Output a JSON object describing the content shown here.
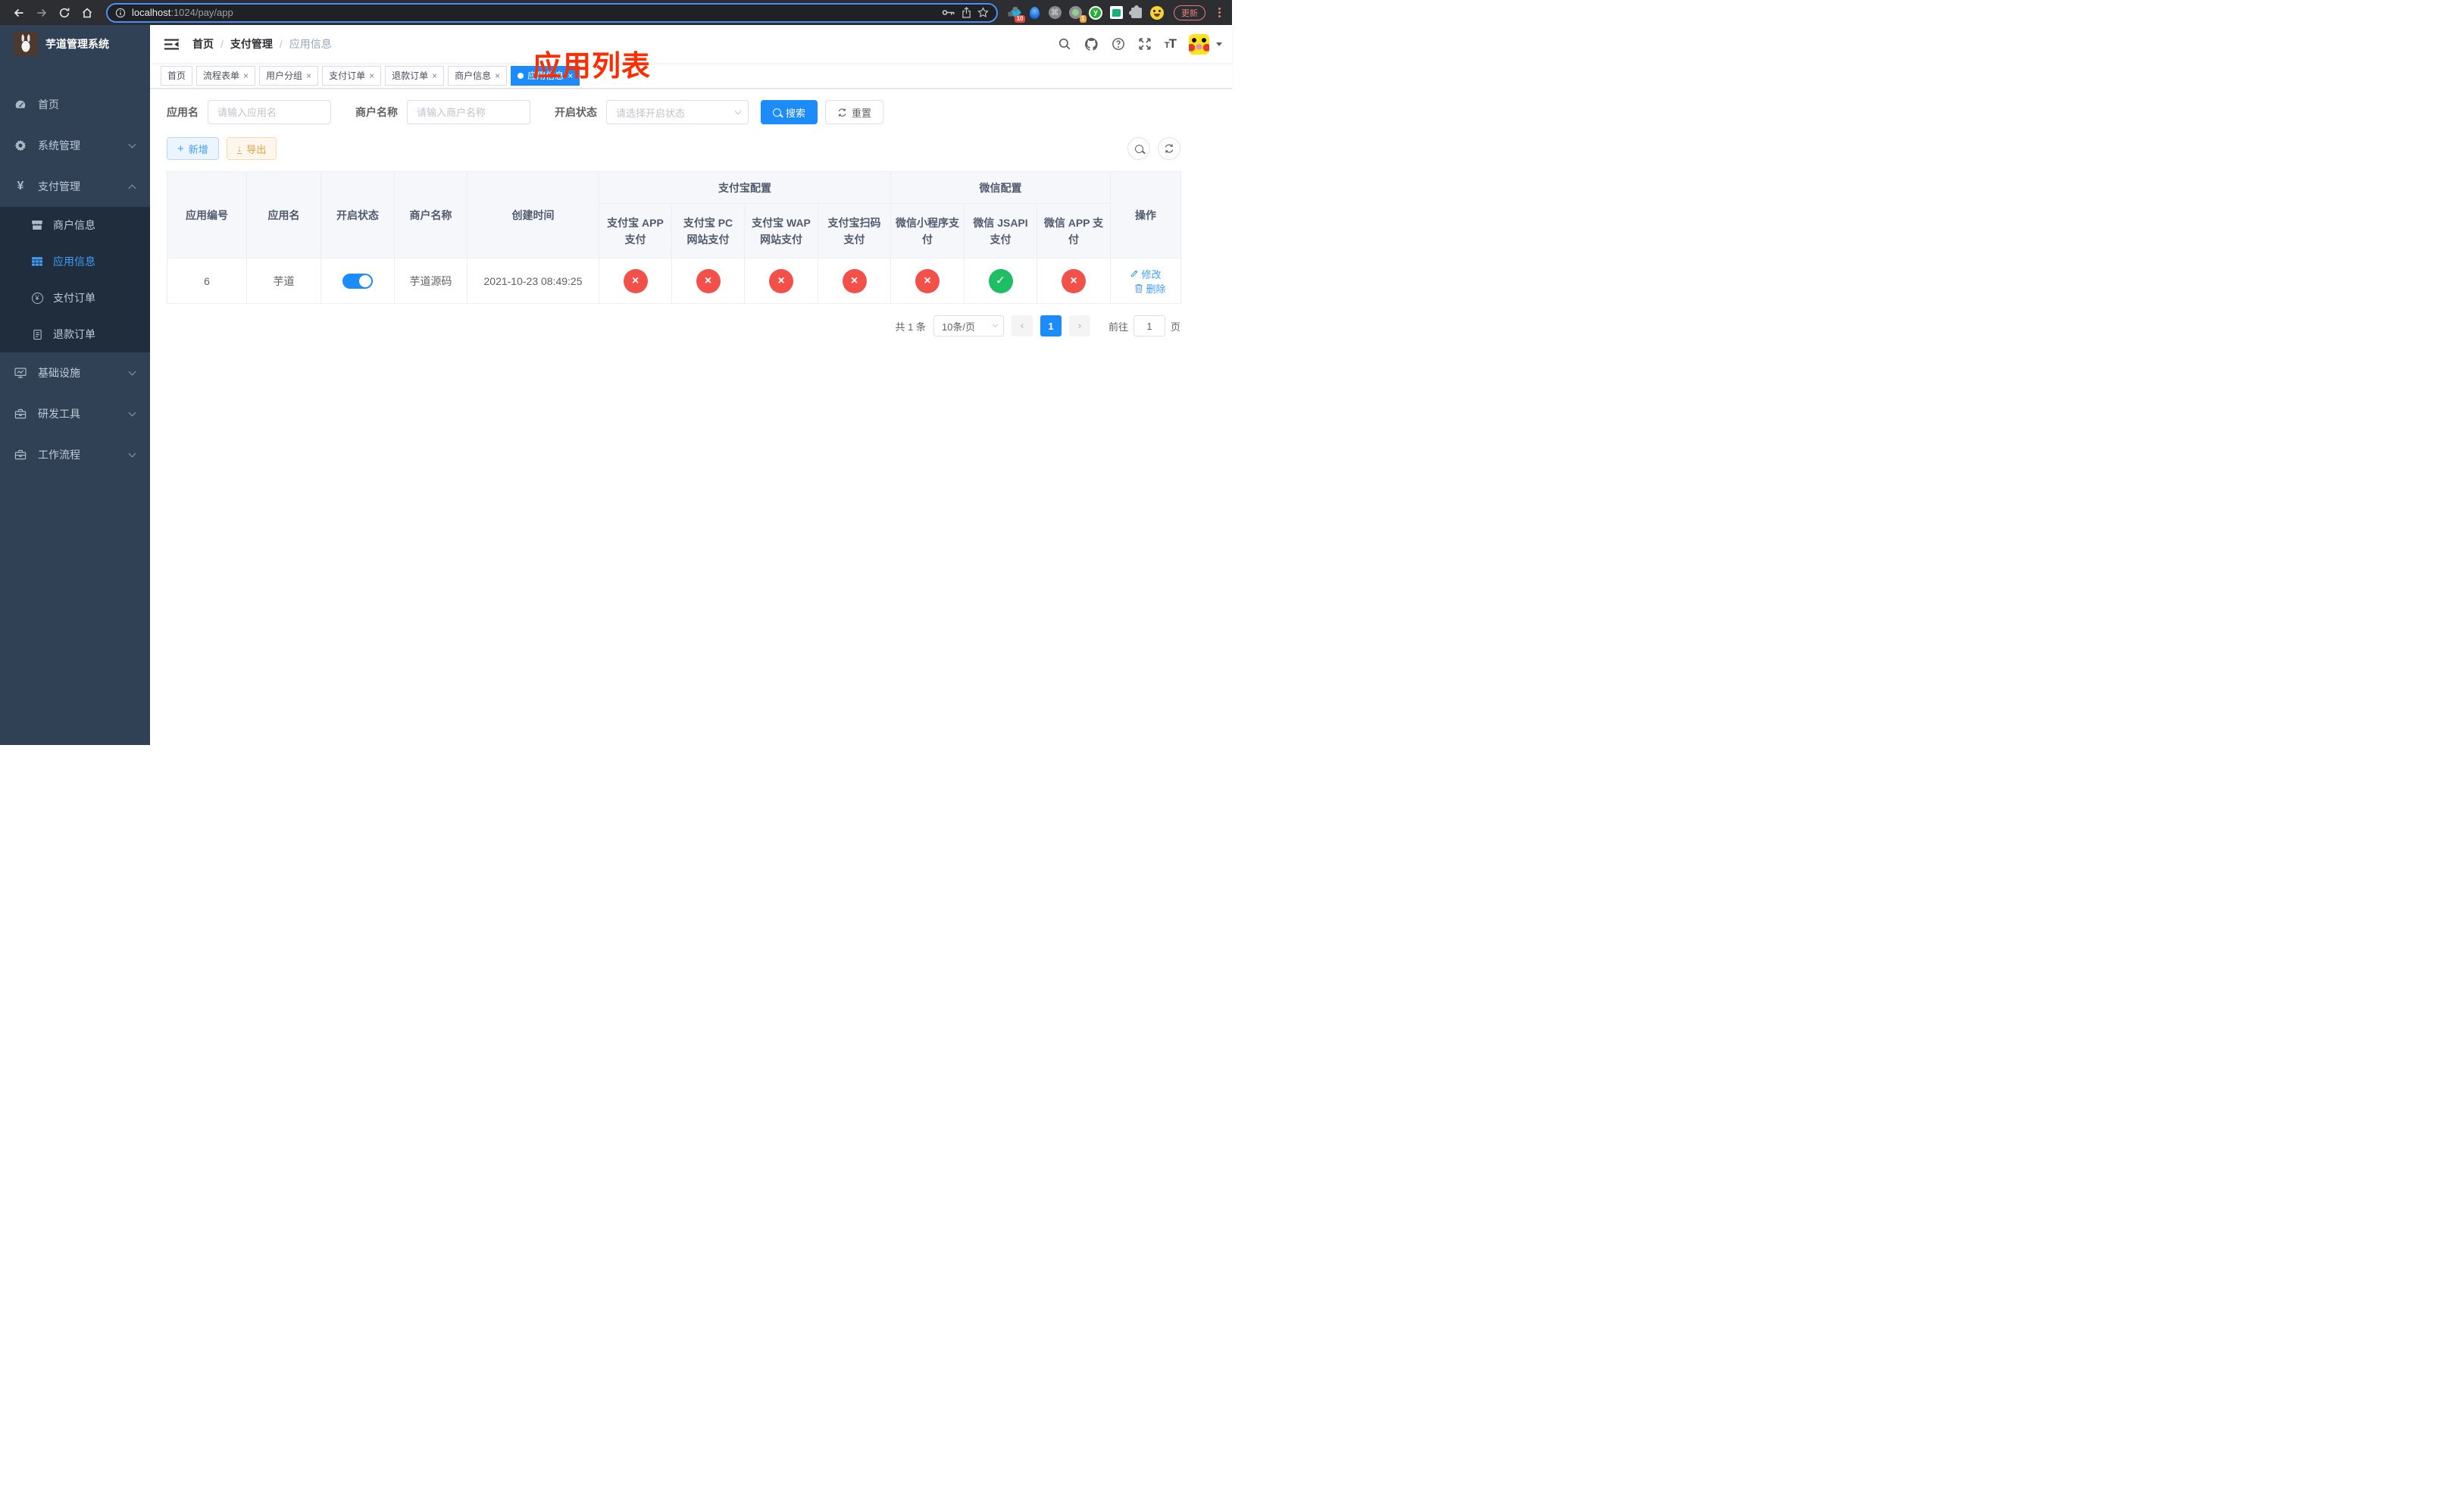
{
  "colors": {
    "accent": "#1b8cfa",
    "link": "#409eff",
    "danger": "#f4504a",
    "success": "#1dbe64",
    "warning": "#e6a23c",
    "sidebar_bg": "#304156",
    "submenu_bg": "#1f2d3d",
    "annotation_red": "#fd2c01"
  },
  "browser": {
    "url_host": "localhost",
    "url_rest": ":1024/pay/app",
    "update_label": "更新",
    "badge_pinned": "10",
    "badge_profile": "1"
  },
  "sidebar": {
    "title": "芋道管理系统",
    "items": [
      {
        "label": "首页"
      },
      {
        "label": "系统管理"
      },
      {
        "label": "支付管理"
      },
      {
        "label": "商户信息"
      },
      {
        "label": "应用信息"
      },
      {
        "label": "支付订单"
      },
      {
        "label": "退款订单"
      },
      {
        "label": "基础设施"
      },
      {
        "label": "研发工具"
      },
      {
        "label": "工作流程"
      }
    ]
  },
  "navbar": {
    "breadcrumb": [
      "首页",
      "支付管理",
      "应用信息"
    ],
    "annotation": "应用列表"
  },
  "tabs": [
    {
      "label": "首页"
    },
    {
      "label": "流程表单"
    },
    {
      "label": "用户分组"
    },
    {
      "label": "支付订单"
    },
    {
      "label": "退款订单"
    },
    {
      "label": "商户信息"
    },
    {
      "label": "应用信息"
    }
  ],
  "filters": {
    "app_name_label": "应用名",
    "app_name_placeholder": "请输入应用名",
    "merchant_label": "商户名称",
    "merchant_placeholder": "请输入商户名称",
    "status_label": "开启状态",
    "status_placeholder": "请选择开启状态",
    "search_label": "搜索",
    "reset_label": "重置"
  },
  "toolbar": {
    "add_label": "新增",
    "export_label": "导出"
  },
  "table": {
    "columns": [
      "应用编号",
      "应用名",
      "开启状态",
      "商户名称",
      "创建时间"
    ],
    "groups": [
      {
        "label": "支付宝配置",
        "children": [
          "支付宝 APP 支付",
          "支付宝 PC 网站支付",
          "支付宝 WAP 网站支付",
          "支付宝扫码支付"
        ]
      },
      {
        "label": "微信配置",
        "children": [
          "微信小程序支付",
          "微信 JSAPI 支付",
          "微信 APP 支付"
        ]
      }
    ],
    "ops_label": "操作",
    "row": {
      "id": "6",
      "name": "芋道",
      "enabled": true,
      "merchant": "芋道源码",
      "created": "2021-10-23 08:49:25",
      "channels": [
        false,
        false,
        false,
        false,
        false,
        true,
        false
      ],
      "edit_label": "修改",
      "delete_label": "删除"
    }
  },
  "pagination": {
    "total": "共 1 条",
    "page_size": "10条/页",
    "page": "1",
    "goto_label": "前往",
    "goto_value": "1",
    "page_unit": "页"
  },
  "icons": {
    "check": "✓",
    "cross": "×"
  }
}
